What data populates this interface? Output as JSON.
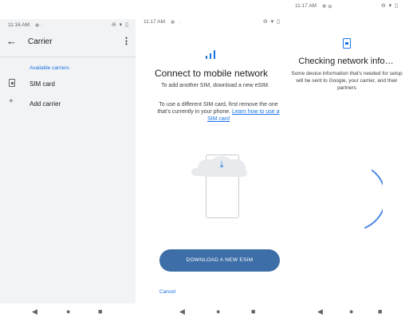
{
  "screen1": {
    "status": {
      "time": "11:16 AM",
      "icons": "⊖ ▾ ▯"
    },
    "appbar": {
      "back_icon": "←",
      "title": "Carrier",
      "more_icon": "⋮"
    },
    "section_label": "Available carriers",
    "rows": [
      {
        "icon": "sim-card-icon",
        "label": "SIM card"
      },
      {
        "icon": "plus-icon",
        "label": "Add carrier"
      }
    ]
  },
  "screen2": {
    "status": {
      "time": "11:17 AM",
      "icons": "⊖ ▾ ▯"
    },
    "headline": "Connect to mobile network",
    "subtitle": "To add another SIM, download a new eSIM.",
    "para_text": "To use a different SIM card, first remove the one that's currently in your phone.",
    "para_link": "Learn how to use a SIM card",
    "download_button": "DOWNLOAD A NEW ESIM",
    "cancel": "Cancel"
  },
  "screen3": {
    "status": {
      "time": "11:17 AM",
      "icons": "⊖ ▾ ▯"
    },
    "headline": "Checking network info…",
    "para": "Some device information that's needed for setup will be sent to Google, your carrier, and their partners"
  },
  "navbar": {
    "back": "◀",
    "home": "●",
    "recents": "■"
  },
  "colors": {
    "accent": "#1a73e8",
    "button": "#3d6ea8",
    "settings_bg": "#f1f3f4"
  }
}
